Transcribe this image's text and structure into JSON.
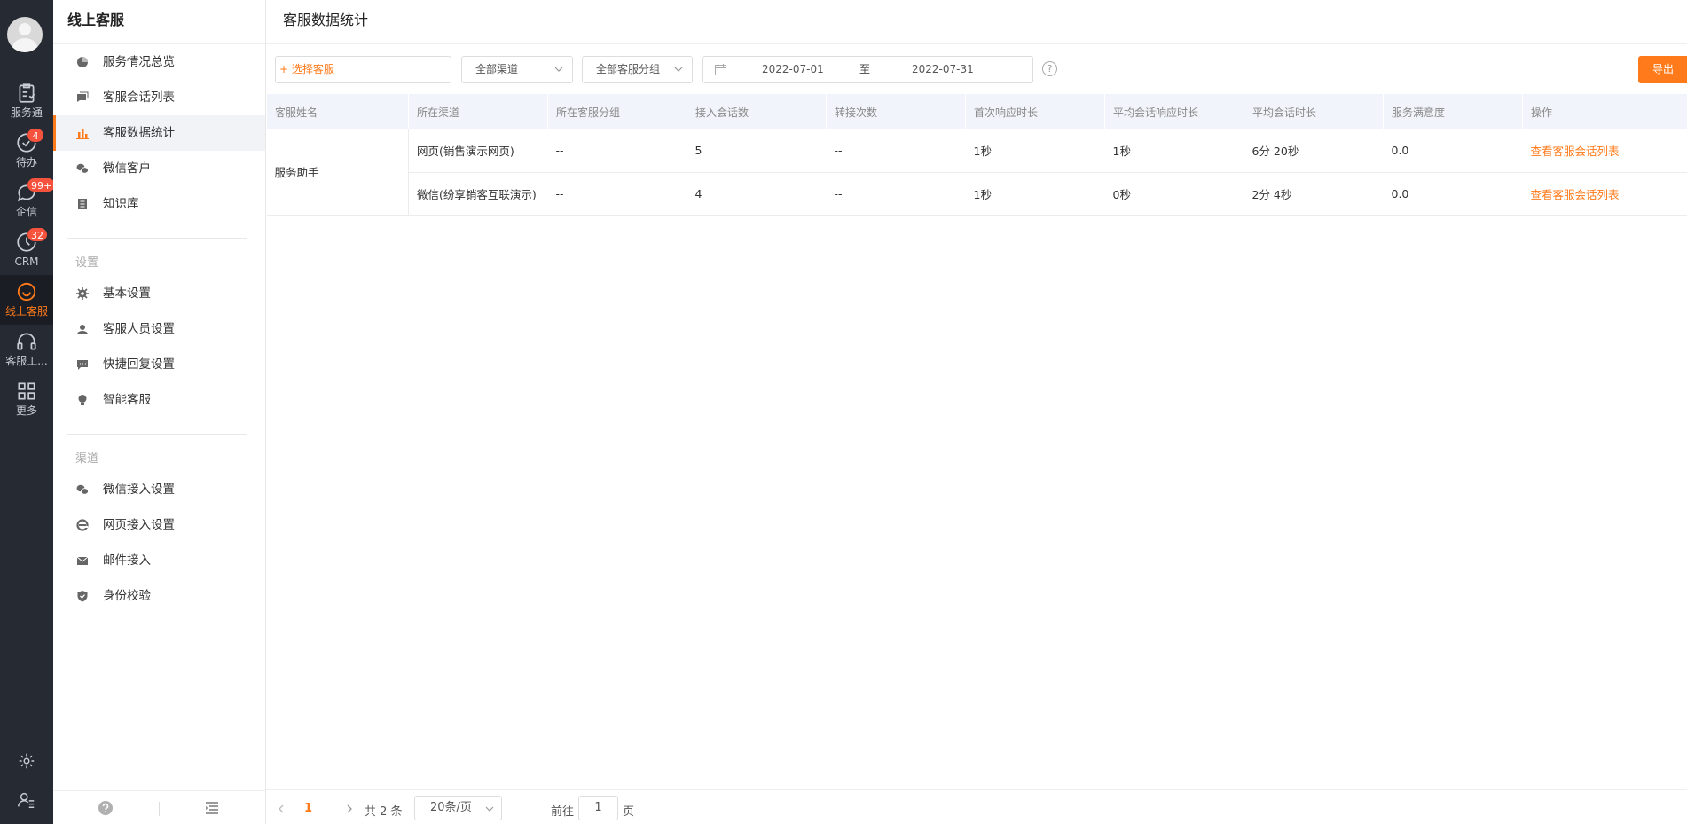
{
  "rail": {
    "items": [
      {
        "label": "服务通",
        "icon": "clipboard-heart-icon"
      },
      {
        "label": "待办",
        "icon": "check-circle-icon",
        "badge": "4"
      },
      {
        "label": "企信",
        "icon": "chat-bubble-icon",
        "badge": "99+"
      },
      {
        "label": "CRM",
        "icon": "clock-icon",
        "badge": "32"
      },
      {
        "label": "线上客服",
        "icon": "smile-bubble-icon",
        "active": true
      },
      {
        "label": "客服工...",
        "icon": "headset-icon"
      },
      {
        "label": "更多",
        "icon": "grid-icon"
      }
    ]
  },
  "sidebar": {
    "title": "线上客服",
    "items": [
      {
        "label": "服务情况总览",
        "icon": "pie-chart-icon"
      },
      {
        "label": "客服会话列表",
        "icon": "chat-list-icon"
      },
      {
        "label": "客服数据统计",
        "icon": "bar-chart-icon",
        "active": true
      },
      {
        "label": "微信客户",
        "icon": "wechat-icon"
      },
      {
        "label": "知识库",
        "icon": "book-icon"
      }
    ],
    "group_settings": "设置",
    "settings_items": [
      {
        "label": "基本设置",
        "icon": "gear-icon"
      },
      {
        "label": "客服人员设置",
        "icon": "agent-icon"
      },
      {
        "label": "快捷回复设置",
        "icon": "quick-reply-icon"
      },
      {
        "label": "智能客服",
        "icon": "bulb-icon"
      }
    ],
    "group_channels": "渠道",
    "channel_items": [
      {
        "label": "微信接入设置",
        "icon": "wechat-icon"
      },
      {
        "label": "网页接入设置",
        "icon": "ie-icon"
      },
      {
        "label": "邮件接入",
        "icon": "mail-icon"
      },
      {
        "label": "身份校验",
        "icon": "shield-check-icon"
      }
    ]
  },
  "main": {
    "title": "客服数据统计",
    "select_agent_label": "+ 选择客服",
    "channel_select": "全部渠道",
    "group_select": "全部客服分组",
    "date_from": "2022-07-01",
    "date_sep": "至",
    "date_to": "2022-07-31",
    "help": "?",
    "export_label": "导出"
  },
  "table": {
    "headers": [
      "客服姓名",
      "所在渠道",
      "所在客服分组",
      "接入会话数",
      "转接次数",
      "首次响应时长",
      "平均会话响应时长",
      "平均会话时长",
      "服务满意度",
      "操作"
    ],
    "agent_name": "服务助手",
    "rows": [
      {
        "channel": "网页(销售演示网页)",
        "group": "--",
        "sessions": "5",
        "transfers": "--",
        "first_response": "1秒",
        "avg_response": "1秒",
        "avg_duration": "6分 20秒",
        "satisfaction": "0.0",
        "action": "查看客服会话列表"
      },
      {
        "channel": "微信(纷享销客互联演示)",
        "group": "--",
        "sessions": "4",
        "transfers": "--",
        "first_response": "1秒",
        "avg_response": "0秒",
        "avg_duration": "2分 4秒",
        "satisfaction": "0.0",
        "action": "查看客服会话列表"
      }
    ]
  },
  "pager": {
    "current": "1",
    "total": "共 2 条",
    "page_size": "20条/页",
    "goto_label": "前往",
    "goto_value": "1",
    "page_suffix": "页"
  },
  "colors": {
    "accent": "#ff7a1a",
    "rail_bg": "#262a33",
    "badge": "#f5533d",
    "header_bg": "#f1f4fa"
  }
}
